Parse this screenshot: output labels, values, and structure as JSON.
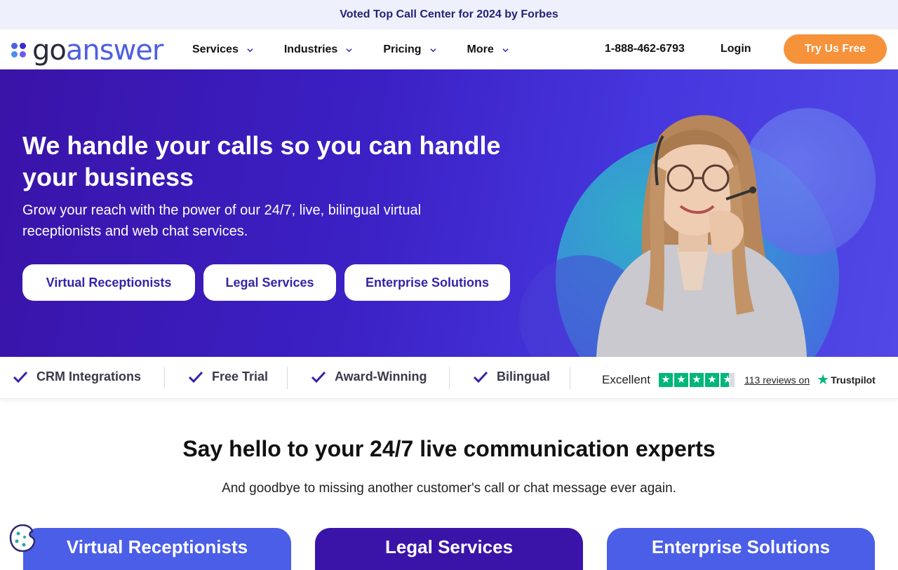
{
  "announcement": {
    "text": "Voted Top Call Center for 2024 by Forbes"
  },
  "header": {
    "logo_text_part1": "go",
    "logo_text_part2": "answer",
    "nav": [
      {
        "label": "Services"
      },
      {
        "label": "Industries"
      },
      {
        "label": "Pricing"
      },
      {
        "label": "More"
      }
    ],
    "phone": "1-888-462-6793",
    "login": "Login",
    "cta": "Try Us Free"
  },
  "hero": {
    "title": "We handle your calls so you can handle your business",
    "subtitle": "Grow your reach with the power of our 24/7, live, bilingual virtual receptionists and web chat services.",
    "buttons": [
      {
        "label": "Virtual Receptionists"
      },
      {
        "label": "Legal Services"
      },
      {
        "label": "Enterprise Solutions"
      }
    ]
  },
  "features": [
    {
      "label": "CRM Integrations"
    },
    {
      "label": "Free Trial"
    },
    {
      "label": "Award-Winning"
    },
    {
      "label": "Bilingual"
    }
  ],
  "trustpilot": {
    "rating_word": "Excellent",
    "stars": 4.5,
    "reviews_text": "113 reviews on",
    "brand": "Trustpilot"
  },
  "section": {
    "title": "Say hello to your 24/7 live communication experts",
    "subtitle": "And goodbye to missing another customer's call or chat message ever again.",
    "cards": [
      {
        "label": "Virtual Receptionists"
      },
      {
        "label": "Legal Services"
      },
      {
        "label": "Enterprise Solutions"
      }
    ]
  },
  "colors": {
    "accent_orange": "#f6923a",
    "brand_purple": "#3b20c4",
    "brand_blue": "#4e5fe0",
    "trustpilot_green": "#00b67a"
  },
  "icons": [
    "chevron-down-icon",
    "check-icon",
    "star-icon",
    "cookie-icon",
    "logo-dots-icon"
  ]
}
